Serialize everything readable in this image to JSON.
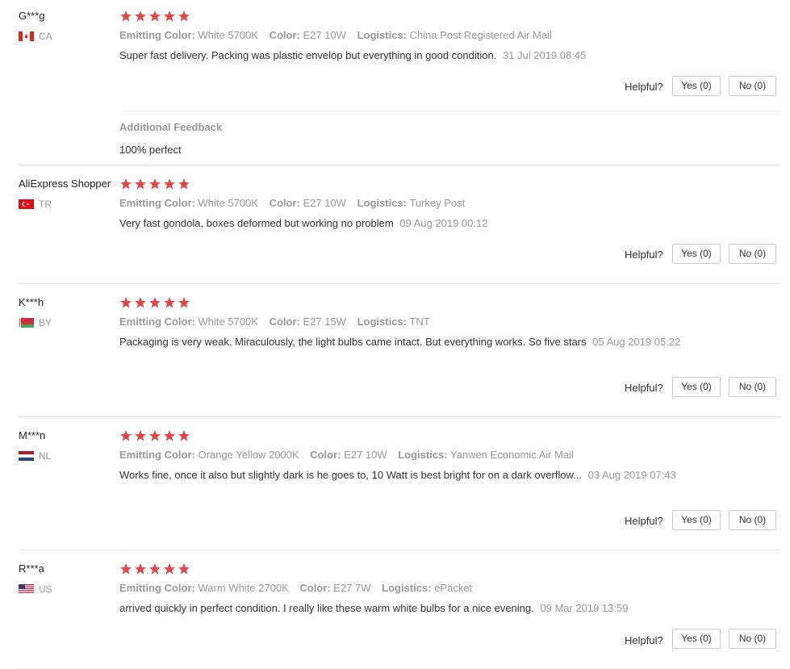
{
  "helpful_label": "Helpful?",
  "colors": {
    "star": "#e5464a",
    "muted": "#999999",
    "text": "#333333"
  },
  "reviews": [
    {
      "name": "G***g",
      "country": "CA",
      "flag": "canada-flag-icon",
      "rating": 5,
      "emitting_color_label": "Emitting Color:",
      "emitting_color": "White 5700K",
      "color_label": "Color:",
      "color": "E27 10W",
      "logistics_label": "Logistics:",
      "logistics": "China Post Registered Air Mail",
      "text": "Super fast delivery. Packing was plastic envelop but everything in good condition.",
      "date": "31 Jul 2019 08:45",
      "yes": "Yes (0)",
      "no": "No (0)",
      "additional_feedback_title": "Additional Feedback",
      "additional_feedback": "100% perfect"
    },
    {
      "name": "AliExpress Shopper",
      "country": "TR",
      "flag": "turkey-flag-icon",
      "rating": 5,
      "emitting_color_label": "Emitting Color:",
      "emitting_color": "White 5700K",
      "color_label": "Color:",
      "color": "E27 10W",
      "logistics_label": "Logistics:",
      "logistics": "Turkey Post",
      "text": "Very fast gondola, boxes deformed but working no problem",
      "date": "09 Aug 2019 00:12",
      "yes": "Yes (0)",
      "no": "No (0)"
    },
    {
      "name": "K***h",
      "country": "BY",
      "flag": "belarus-flag-icon",
      "rating": 5,
      "emitting_color_label": "Emitting Color:",
      "emitting_color": "White 5700K",
      "color_label": "Color:",
      "color": "E27 15W",
      "logistics_label": "Logistics:",
      "logistics": "TNT",
      "text": "Packaging is very weak. Miraculously, the light bulbs came intact. But everything works. So five stars",
      "date": "05 Aug 2019 05:22",
      "yes": "Yes (0)",
      "no": "No (0)"
    },
    {
      "name": "M***n",
      "country": "NL",
      "flag": "netherlands-flag-icon",
      "rating": 5,
      "emitting_color_label": "Emitting Color:",
      "emitting_color": "Orange Yellow 2000K",
      "color_label": "Color:",
      "color": "E27 10W",
      "logistics_label": "Logistics:",
      "logistics": "Yanwen Economic Air Mail",
      "text": "Works fine, once it also but slightly dark is he goes to, 10 Watt is best bright for on a dark overflow...",
      "date": "03 Aug 2019 07:43",
      "yes": "Yes (0)",
      "no": "No (0)"
    },
    {
      "name": "R***a",
      "country": "US",
      "flag": "us-flag-icon",
      "rating": 5,
      "emitting_color_label": "Emitting Color:",
      "emitting_color": "Warm White 2700K",
      "color_label": "Color:",
      "color": "E27 7W",
      "logistics_label": "Logistics:",
      "logistics": "ePacket",
      "text": "arrived quickly in perfect condition. I really like these warm white bulbs for a nice evening.",
      "date": "09 Mar 2019 13:59",
      "yes": "Yes (0)",
      "no": "No (0)"
    }
  ]
}
